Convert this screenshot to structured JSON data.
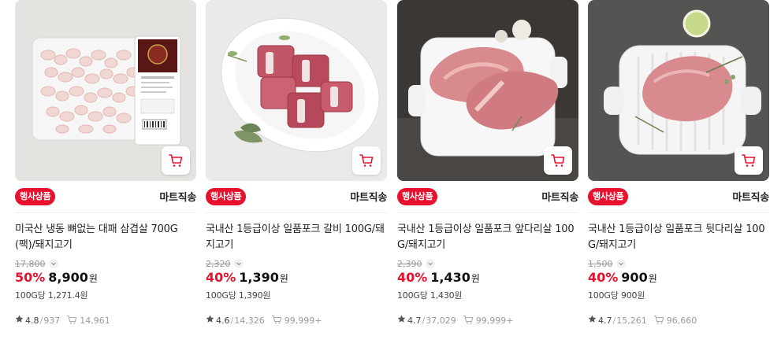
{
  "colors": {
    "accent": "#e8112d",
    "muted": "#999999"
  },
  "products": [
    {
      "badge": "행사상품",
      "delivery": "마트직송",
      "title": "미국산 냉동 뼈없는 대패 삼겹살 700G(팩)/돼지고기",
      "original_price": "17,800",
      "discount": "50%",
      "price": "8,900",
      "currency": "원",
      "unit_price": "100G당 1,271.4원",
      "rating": "4.8",
      "reviews": "937",
      "purchases": "14,961",
      "image": "frozen-pork-belly-package"
    },
    {
      "badge": "행사상품",
      "delivery": "마트직송",
      "title": "국내산 1등급이상 일품포크 갈비 100G/돼지고기",
      "original_price": "2,320",
      "discount": "40%",
      "price": "1,390",
      "currency": "원",
      "unit_price": "100G당 1,390원",
      "rating": "4.6",
      "reviews": "14,326",
      "purchases": "99,999+",
      "image": "pork-ribs-bowl"
    },
    {
      "badge": "행사상품",
      "delivery": "마트직송",
      "title": "국내산 1등급이상 일품포크 앞다리살 100G/돼지고기",
      "original_price": "2,390",
      "discount": "40%",
      "price": "1,430",
      "currency": "원",
      "unit_price": "100G당 1,430원",
      "rating": "4.7",
      "reviews": "37,029",
      "purchases": "99,999+",
      "image": "pork-shoulder-tray"
    },
    {
      "badge": "행사상품",
      "delivery": "마트직송",
      "title": "국내산 1등급이상 일품포크 뒷다리살 100G/돼지고기",
      "original_price": "1,500",
      "discount": "40%",
      "price": "900",
      "currency": "원",
      "unit_price": "100G당 900원",
      "rating": "4.7",
      "reviews": "15,261",
      "purchases": "96,660",
      "image": "pork-hind-leg-grill-plate"
    }
  ]
}
